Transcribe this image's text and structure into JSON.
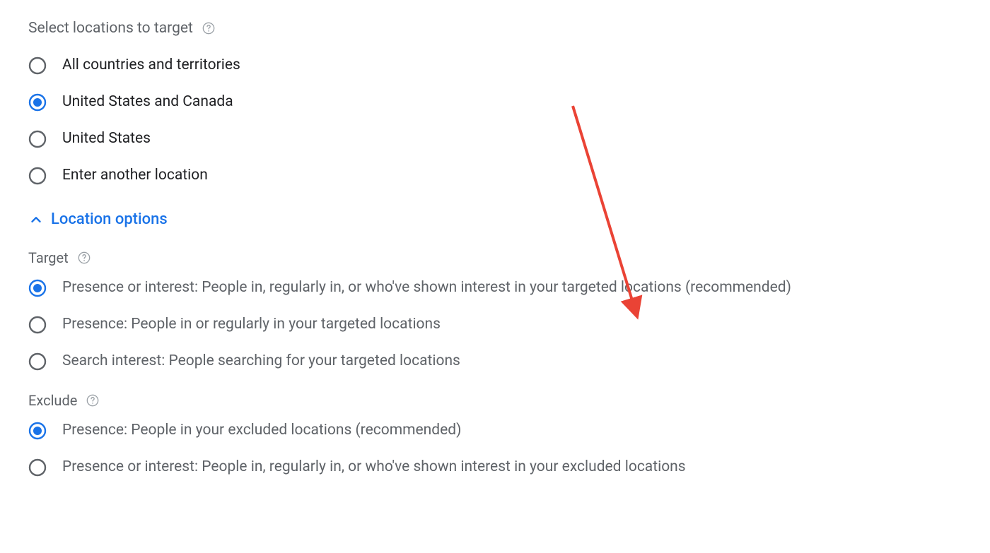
{
  "colors": {
    "blue": "#1a73e8",
    "arrow": "#ea4335"
  },
  "select_locations": {
    "heading": "Select locations to target",
    "options": [
      {
        "label": "All countries and territories",
        "selected": false
      },
      {
        "label": "United States and Canada",
        "selected": true
      },
      {
        "label": "United States",
        "selected": false
      },
      {
        "label": "Enter another location",
        "selected": false
      }
    ]
  },
  "location_options": {
    "toggle_label": "Location options",
    "expanded": true,
    "target": {
      "heading": "Target",
      "options": [
        {
          "label": "Presence or interest: People in, regularly in, or who've shown interest in your targeted locations (recommended)",
          "selected": true
        },
        {
          "label": "Presence: People in or regularly in your targeted locations",
          "selected": false
        },
        {
          "label": "Search interest: People searching for your targeted locations",
          "selected": false
        }
      ]
    },
    "exclude": {
      "heading": "Exclude",
      "options": [
        {
          "label": "Presence: People in your excluded locations (recommended)",
          "selected": true
        },
        {
          "label": "Presence or interest: People in, regularly in, or who've shown interest in your excluded locations",
          "selected": false
        }
      ]
    }
  }
}
